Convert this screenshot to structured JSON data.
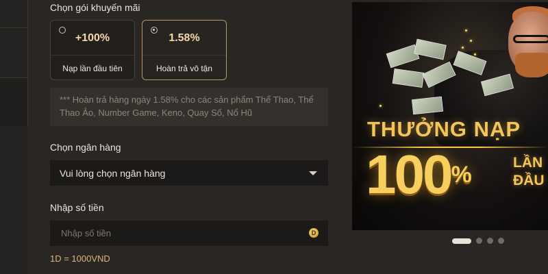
{
  "promo": {
    "label": "Chọn gói khuyến mãi",
    "options": [
      {
        "value": "+100%",
        "name": "Nạp lần đầu tiên",
        "selected": false
      },
      {
        "value": "1.58%",
        "name": "Hoàn trả vô tận",
        "selected": true
      }
    ],
    "note": "*** Hoàn trả hàng ngày 1.58% cho các sản phẩm Thể Thao, Thể Thao Ảo, Number Game, Keno, Quay Số, Nổ Hũ"
  },
  "bank": {
    "label": "Chọn ngân hàng",
    "placeholder": "Vui lòng chọn ngân hàng"
  },
  "amount": {
    "label": "Nhập số tiền",
    "placeholder": "Nhập số tiền",
    "coin_symbol": "D",
    "rate": "1D = 1000VND"
  },
  "banner": {
    "headline": "THƯỞNG NẠP",
    "big": "100",
    "percent": "%",
    "line1": "LẦN",
    "line2": "ĐẦU",
    "slide_count": 4,
    "active_slide": 1
  },
  "colors": {
    "accent_gold": "#d9b977",
    "selected_border": "#b8985e",
    "background": "#292623"
  }
}
